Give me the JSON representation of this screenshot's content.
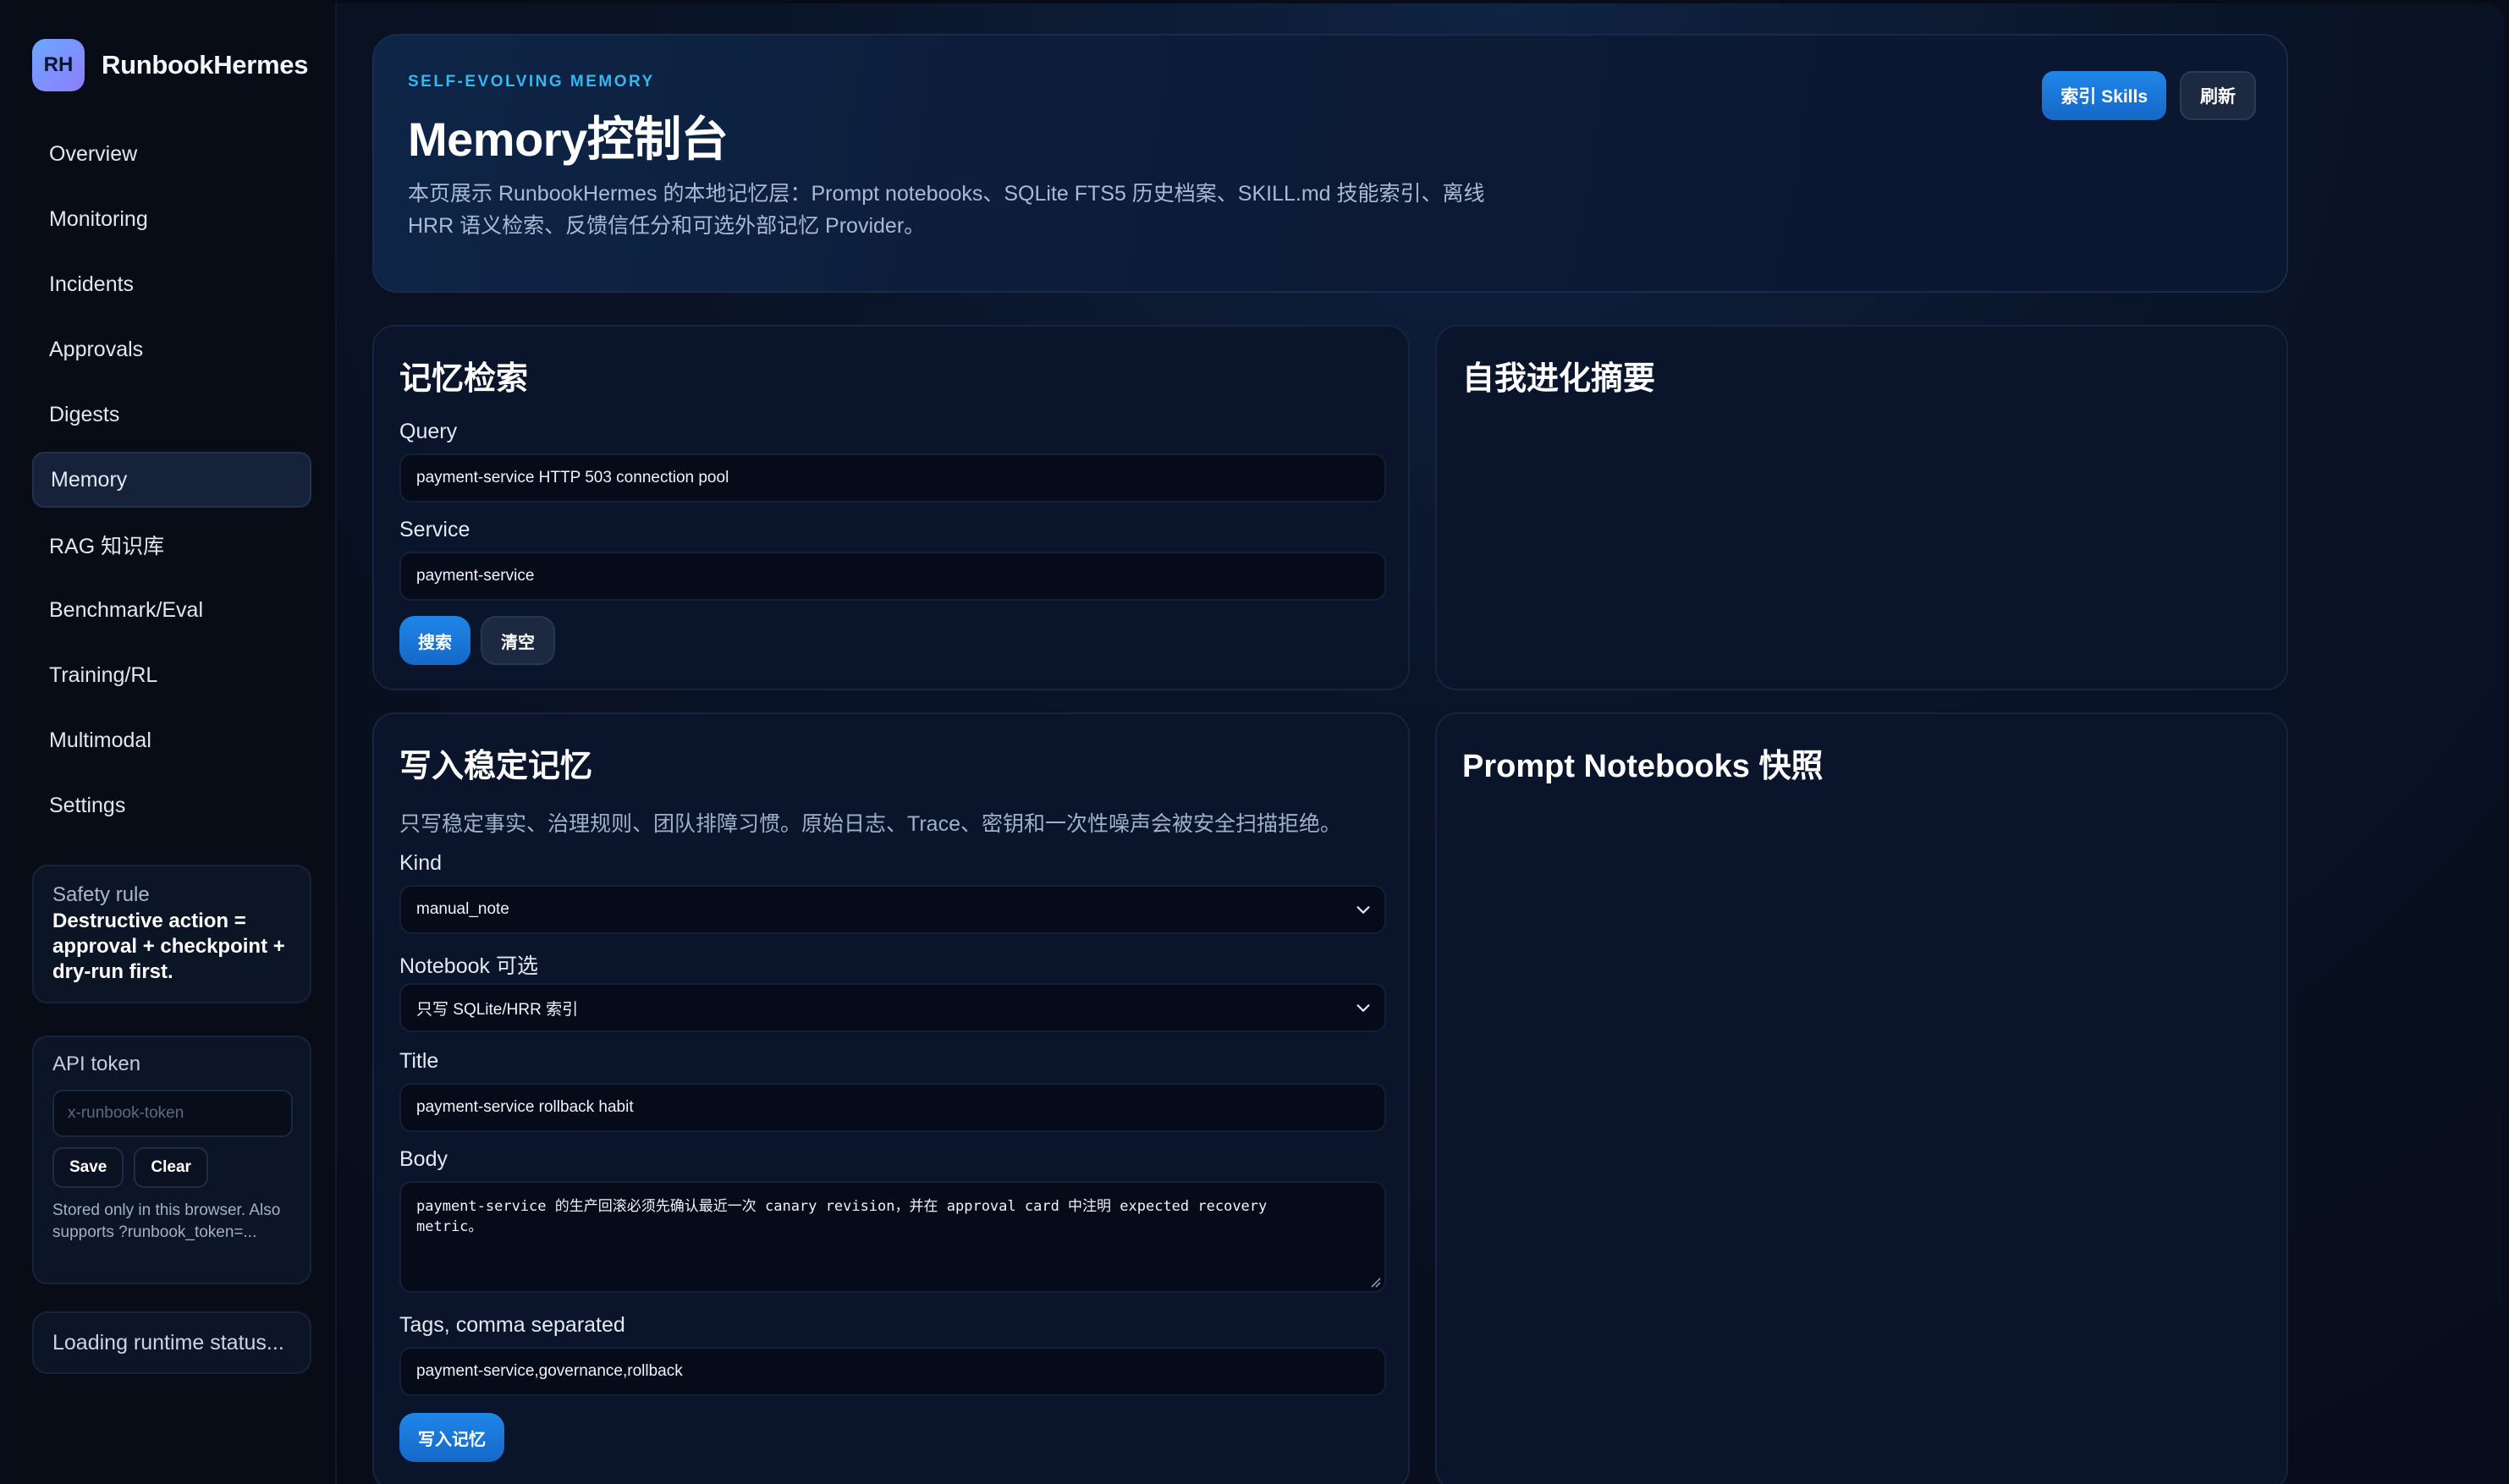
{
  "sidebar": {
    "brand_logo": "RH",
    "brand_name": "RunbookHermes",
    "nav": [
      {
        "label": "Overview"
      },
      {
        "label": "Monitoring"
      },
      {
        "label": "Incidents"
      },
      {
        "label": "Approvals"
      },
      {
        "label": "Digests"
      },
      {
        "label": "Memory",
        "active": true
      },
      {
        "label": "RAG 知识库"
      },
      {
        "label": "Benchmark/Eval"
      },
      {
        "label": "Training/RL"
      },
      {
        "label": "Multimodal"
      },
      {
        "label": "Settings"
      }
    ],
    "safety": {
      "title": "Safety rule",
      "body": "Destructive action = approval + checkpoint + dry-run first."
    },
    "token": {
      "title": "API token",
      "placeholder": "x-runbook-token",
      "save_label": "Save",
      "clear_label": "Clear",
      "note": "Stored only in this browser. Also supports ?runbook_token=..."
    },
    "runtime_status": "Loading runtime status..."
  },
  "hero": {
    "eyebrow": "SELF-EVOLVING MEMORY",
    "title": "Memory控制台",
    "description": "本页展示 RunbookHermes 的本地记忆层：Prompt notebooks、SQLite FTS5 历史档案、SKILL.md 技能索引、离线 HRR 语义检索、反馈信任分和可选外部记忆 Provider。",
    "index_skills_label": "索引 Skills",
    "refresh_label": "刷新"
  },
  "search": {
    "title": "记忆检索",
    "query_label": "Query",
    "query_value": "payment-service HTTP 503 connection pool",
    "service_label": "Service",
    "service_value": "payment-service",
    "search_label": "搜索",
    "clear_label": "清空"
  },
  "evolve": {
    "title": "自我进化摘要"
  },
  "write": {
    "title": "写入稳定记忆",
    "note": "只写稳定事实、治理规则、团队排障习惯。原始日志、Trace、密钥和一次性噪声会被安全扫描拒绝。",
    "kind_label": "Kind",
    "kind_value": "manual_note",
    "notebook_label": "Notebook 可选",
    "notebook_value": "只写 SQLite/HRR 索引",
    "title_label": "Title",
    "title_value": "payment-service rollback habit",
    "body_label": "Body",
    "body_value": "payment-service 的生产回滚必须先确认最近一次 canary revision，并在 approval card 中注明 expected recovery metric。",
    "tags_label": "Tags, comma separated",
    "tags_value": "payment-service,governance,rollback",
    "submit_label": "写入记忆"
  },
  "notebooks": {
    "title": "Prompt Notebooks 快照"
  },
  "colors": {
    "accent": "#1f86e8",
    "eyebrow": "#33b8f0",
    "background": "#070c18"
  }
}
